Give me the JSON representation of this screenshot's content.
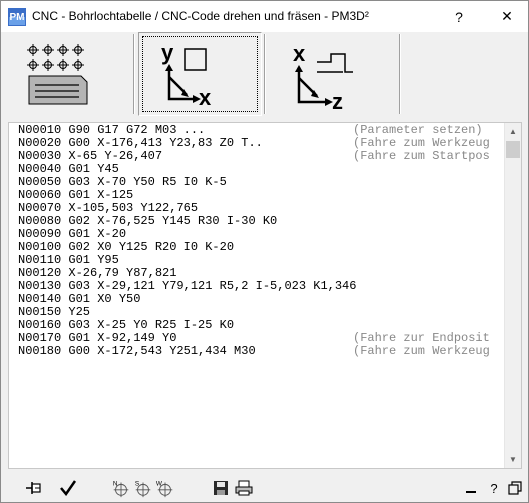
{
  "window": {
    "title": "CNC - Bohrlochtabelle / CNC-Code drehen und fräsen   -   PM3D²",
    "help_label": "?",
    "close_label": "✕"
  },
  "toolbar": {
    "buttons": [
      {
        "name": "drill-table",
        "icon": "drill-table-icon",
        "pressed": false
      },
      {
        "name": "milling-xy",
        "icon": "milling-xy-icon",
        "pressed": true
      },
      {
        "name": "turning-xz",
        "icon": "turning-xz-icon",
        "pressed": false
      }
    ],
    "milling_axis_y": "y",
    "milling_axis_x": "x",
    "turning_axis_x": "x",
    "turning_axis_z": "z"
  },
  "code": {
    "lines": [
      {
        "cmd": "N00010 G90 G17 G72 M03 ...",
        "comment": "(Parameter setzen)"
      },
      {
        "cmd": "N00020 G00 X-176,413 Y23,83 Z0 T..",
        "comment": "(Fahre zum Werkzeug"
      },
      {
        "cmd": "N00030 X-65 Y-26,407",
        "comment": "(Fahre zum Startpos"
      },
      {
        "cmd": "N00040 G01 Y45",
        "comment": ""
      },
      {
        "cmd": "N00050 G03 X-70 Y50 R5 I0 K-5",
        "comment": ""
      },
      {
        "cmd": "N00060 G01 X-125",
        "comment": ""
      },
      {
        "cmd": "N00070 X-105,503 Y122,765",
        "comment": ""
      },
      {
        "cmd": "N00080 G02 X-76,525 Y145 R30 I-30 K0",
        "comment": ""
      },
      {
        "cmd": "N00090 G01 X-20",
        "comment": ""
      },
      {
        "cmd": "N00100 G02 X0 Y125 R20 I0 K-20",
        "comment": ""
      },
      {
        "cmd": "N00110 G01 Y95",
        "comment": ""
      },
      {
        "cmd": "N00120 X-26,79 Y87,821",
        "comment": ""
      },
      {
        "cmd": "N00130 G03 X-29,121 Y79,121 R5,2 I-5,023 K1,346",
        "comment": ""
      },
      {
        "cmd": "N00140 G01 X0 Y50",
        "comment": ""
      },
      {
        "cmd": "N00150 Y25",
        "comment": ""
      },
      {
        "cmd": "N00160 G03 X-25 Y0 R25 I-25 K0",
        "comment": ""
      },
      {
        "cmd": "N00170 G01 X-92,149 Y0",
        "comment": "(Fahre zur Endposit"
      },
      {
        "cmd": "N00180 G00 X-172,543 Y251,434 M30",
        "comment": "(Fahre zum Werkzeug"
      }
    ]
  },
  "scrollbar": {
    "up_arrow": "▲",
    "down_arrow": "▼"
  },
  "statusbar": {
    "icons": [
      "pin-icon",
      "checkmark-icon",
      "crosshair-n-icon",
      "crosshair-s-icon",
      "crosshair-w-icon",
      "save-icon",
      "print-icon",
      "minimize-icon",
      "help-icon",
      "restore-icon"
    ],
    "crosshair_n_label": "N",
    "crosshair_s_label": "S",
    "crosshair_w_label": "W",
    "help_label": "?"
  },
  "colors": {
    "comment": "#888888",
    "text": "#000000",
    "code_bg": "#ffffff",
    "chrome": "#f0f0f0"
  }
}
